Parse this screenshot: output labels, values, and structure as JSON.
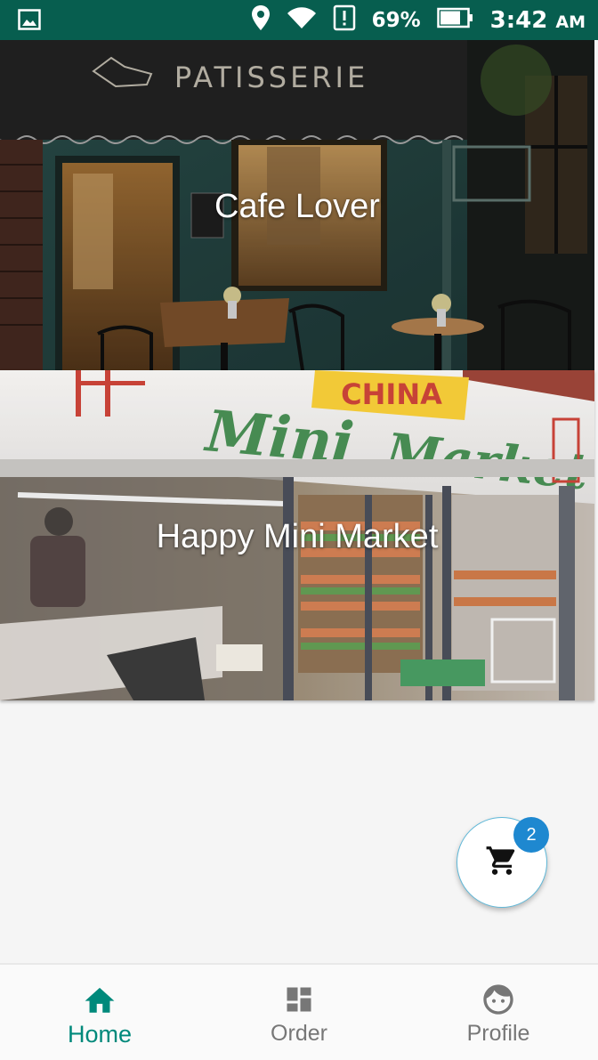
{
  "status_bar": {
    "battery": "69%",
    "time": "3:42",
    "time_suffix": "AM",
    "icons": [
      "image-icon",
      "location-pin-icon",
      "wifi-icon",
      "alert-icon",
      "battery-icon"
    ]
  },
  "stores": [
    {
      "name": "Cafe Lover",
      "image": "patisserie-cafe-storefront-photo",
      "sign_text": "PATISSERIE"
    },
    {
      "name": "Happy Mini Market",
      "image": "china-mini-market-storefront-photo",
      "sign_text": [
        "CHINA",
        "Mini",
        "Market"
      ]
    }
  ],
  "cart": {
    "count": "2",
    "icon": "shopping-cart-icon"
  },
  "bottom_nav": {
    "items": [
      {
        "label": "Home",
        "icon": "home-icon",
        "active": true
      },
      {
        "label": "Order",
        "icon": "dashboard-icon",
        "active": false
      },
      {
        "label": "Profile",
        "icon": "face-icon",
        "active": false
      }
    ]
  },
  "colors": {
    "status_bar": "#075e4f",
    "accent": "#00897b",
    "badge": "#1e88d0",
    "nav_inactive": "#777777"
  }
}
